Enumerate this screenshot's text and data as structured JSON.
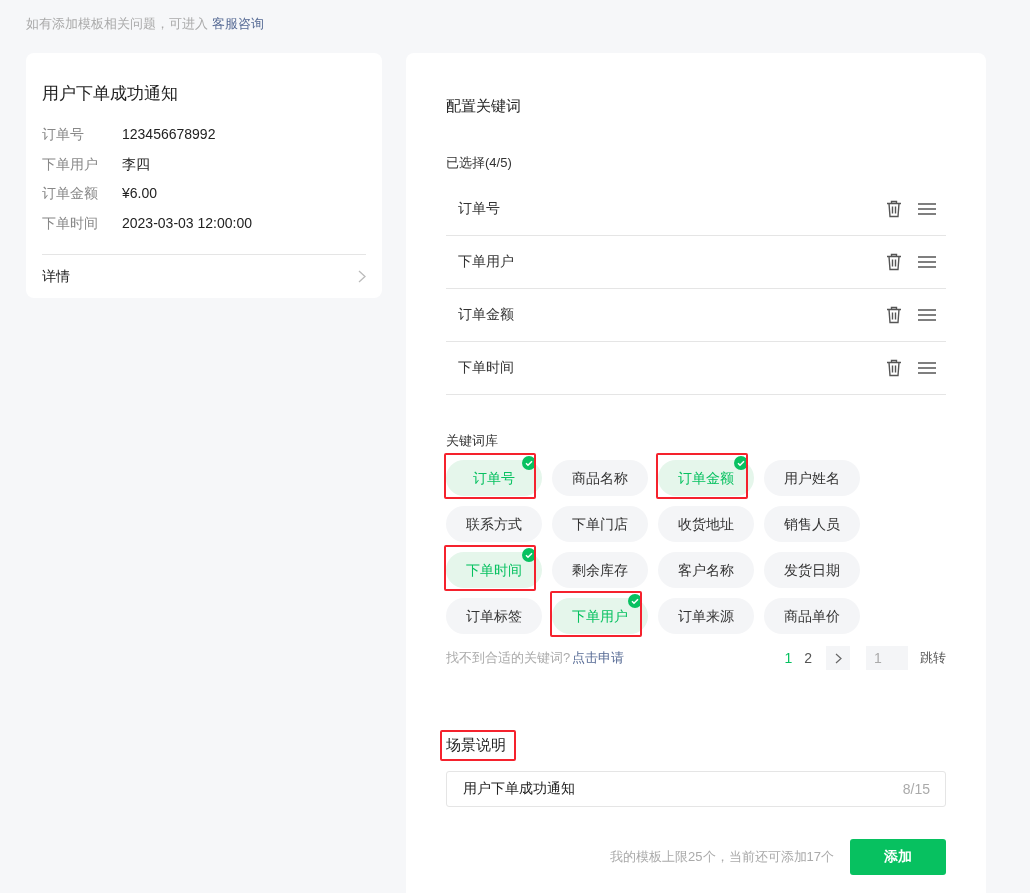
{
  "notice": {
    "text": "如有添加模板相关问题，可进入",
    "link": "客服咨询"
  },
  "preview": {
    "title": "用户下单成功通知",
    "fields": [
      {
        "label": "订单号",
        "value": "123456678992"
      },
      {
        "label": "下单用户",
        "value": "李四"
      },
      {
        "label": "订单金额",
        "value": "¥6.00"
      },
      {
        "label": "下单时间",
        "value": "2023-03-03 12:00:00"
      }
    ],
    "details": "详情"
  },
  "config": {
    "title": "配置关键词",
    "selected_label": "已选择(4/5)",
    "selected": [
      "订单号",
      "下单用户",
      "订单金额",
      "下单时间"
    ],
    "library_label": "关键词库",
    "tags": [
      {
        "label": "订单号",
        "selected": true,
        "highlighted": true
      },
      {
        "label": "商品名称",
        "selected": false,
        "highlighted": false
      },
      {
        "label": "订单金额",
        "selected": true,
        "highlighted": true
      },
      {
        "label": "用户姓名",
        "selected": false,
        "highlighted": false
      },
      {
        "label": "联系方式",
        "selected": false,
        "highlighted": false
      },
      {
        "label": "下单门店",
        "selected": false,
        "highlighted": false
      },
      {
        "label": "收货地址",
        "selected": false,
        "highlighted": false
      },
      {
        "label": "销售人员",
        "selected": false,
        "highlighted": false
      },
      {
        "label": "下单时间",
        "selected": true,
        "highlighted": true
      },
      {
        "label": "剩余库存",
        "selected": false,
        "highlighted": false
      },
      {
        "label": "客户名称",
        "selected": false,
        "highlighted": false
      },
      {
        "label": "发货日期",
        "selected": false,
        "highlighted": false
      },
      {
        "label": "订单标签",
        "selected": false,
        "highlighted": false
      },
      {
        "label": "下单用户",
        "selected": true,
        "highlighted": true
      },
      {
        "label": "订单来源",
        "selected": false,
        "highlighted": false
      },
      {
        "label": "商品单价",
        "selected": false,
        "highlighted": false
      }
    ],
    "missing_text": "找不到合适的关键词?",
    "apply_link": "点击申请",
    "pages": [
      {
        "label": "1",
        "selected": true
      },
      {
        "label": "2",
        "selected": false
      }
    ],
    "jump_value": "1",
    "jump_label": "跳转",
    "scene_title": "场景说明",
    "scene_highlighted": true,
    "scene_value": "用户下单成功通知",
    "scene_count": "8/15",
    "limit_text": "我的模板上限25个，当前还可添加17个",
    "add_button": "添加"
  }
}
